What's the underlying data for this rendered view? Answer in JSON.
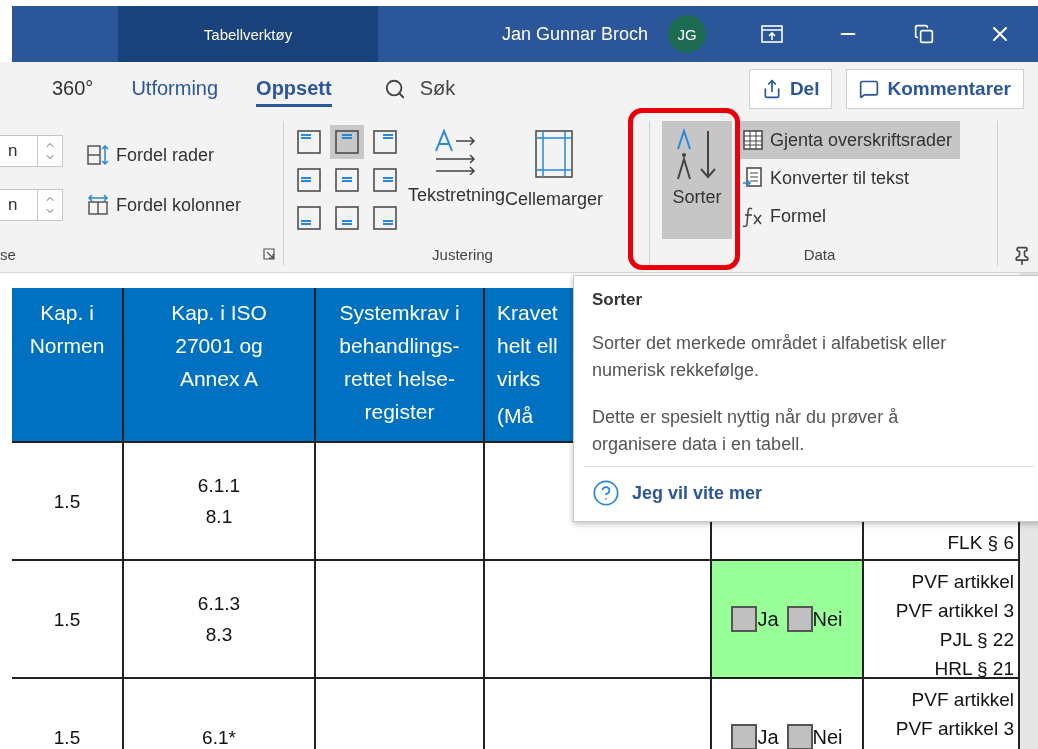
{
  "title_bar": {
    "context_tab": "Tabellverktøy",
    "user": "Jan Gunnar Broch",
    "avatar": "JG"
  },
  "tabs": [
    {
      "label": "360°",
      "selected": false,
      "contextual": false
    },
    {
      "label": "Utforming",
      "selected": false,
      "contextual": true
    },
    {
      "label": "Oppsett",
      "selected": true,
      "contextual": true
    }
  ],
  "search": {
    "label": "Søk"
  },
  "actions": [
    {
      "label": "Del",
      "kind": "share"
    },
    {
      "label": "Kommentarer",
      "kind": "comment"
    }
  ],
  "ribbon": {
    "size_group": {
      "fields": [
        "n",
        "n"
      ],
      "commands": [
        {
          "label": "Fordel rader",
          "kind": "rows"
        },
        {
          "label": "Fordel kolonner",
          "kind": "columns"
        }
      ],
      "label": "se"
    },
    "alignment_group": {
      "buttons": [
        {
          "selected": false
        },
        {
          "selected": true
        },
        {
          "selected": false
        },
        {
          "selected": false
        },
        {
          "selected": false
        },
        {
          "selected": false
        },
        {
          "selected": false
        },
        {
          "selected": false
        },
        {
          "selected": false
        }
      ],
      "commands": [
        {
          "label": "Tekstretning",
          "kind": "direction"
        },
        {
          "label": "Cellemarger",
          "kind": "margins"
        }
      ],
      "label": "Justering"
    },
    "data_group": {
      "sort": {
        "label": "Sorter",
        "selected": true
      },
      "commands": [
        {
          "label": "Gjenta overskriftsrader",
          "kind": "repeat",
          "selected": true
        },
        {
          "label": "Konverter til tekst",
          "kind": "convert",
          "selected": false
        },
        {
          "label": "Formel",
          "kind": "formula",
          "selected": false
        }
      ],
      "label": "Data"
    }
  },
  "table": {
    "columns": [
      {
        "lines": [
          "Kap. i",
          "Normen"
        ]
      },
      {
        "lines": [
          "Kap. i ISO",
          "27001 og",
          "Annex A"
        ]
      },
      {
        "lines": [
          "Systemkrav i",
          "behandlings-",
          "rettet helse-",
          "register"
        ]
      },
      {
        "lines": [
          "Kravet",
          "helt ell",
          "virks",
          "(Må"
        ]
      }
    ],
    "rows": [
      {
        "cells": [
          {
            "kind": "text",
            "lines": [
              "1.5"
            ]
          },
          {
            "kind": "text",
            "lines": [
              "6.1.1",
              "8.1"
            ]
          },
          {
            "kind": "empty"
          },
          {
            "kind": "empty"
          },
          {
            "kind": "empty"
          },
          {
            "kind": "refs_bottom",
            "lines": [
              "FLK § 6"
            ]
          }
        ]
      },
      {
        "cells": [
          {
            "kind": "text",
            "lines": [
              "1.5"
            ]
          },
          {
            "kind": "text",
            "lines": [
              "6.1.3",
              "8.3"
            ]
          },
          {
            "kind": "empty"
          },
          {
            "kind": "empty"
          },
          {
            "kind": "choice",
            "color": "#99ff99",
            "options": [
              {
                "label": "Ja",
                "checked": false
              },
              {
                "label": "Nei",
                "checked": false
              }
            ]
          },
          {
            "kind": "refs",
            "lines": [
              "PVF artikkel",
              "PVF artikkel 3",
              "PJL § 22",
              "HRL § 21"
            ]
          }
        ]
      },
      {
        "cells": [
          {
            "kind": "text",
            "lines": [
              "1.5"
            ]
          },
          {
            "kind": "text",
            "lines": [
              "6.1*"
            ]
          },
          {
            "kind": "empty"
          },
          {
            "kind": "empty"
          },
          {
            "kind": "choice",
            "options": [
              {
                "label": "Ja",
                "checked": false
              },
              {
                "label": "Nei",
                "checked": false
              }
            ]
          },
          {
            "kind": "refs",
            "lines": [
              "PVF artikkel",
              "PVF artikkel 3"
            ]
          }
        ]
      }
    ]
  },
  "tooltip": {
    "title": "Sorter",
    "paragraphs": [
      "Sorter det merkede området i alfabetisk eller numerisk rekkefølge.",
      "Dette er spesielt nyttig når du prøver å organisere data i en tabell."
    ],
    "link": "Jeg vil vite mer"
  }
}
